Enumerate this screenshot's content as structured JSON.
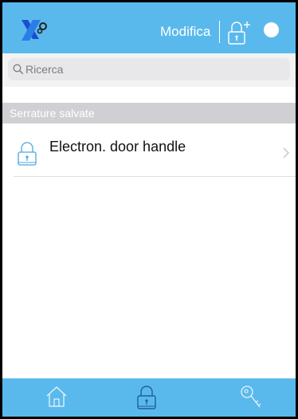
{
  "header": {
    "logo": "x-brand-logo",
    "edit_label": "Modifica",
    "add_lock_icon": "lock-plus-icon",
    "status_dot_color": "#ffffff",
    "bar_color": "#5ab9ec"
  },
  "search": {
    "placeholder": "Ricerca",
    "value": ""
  },
  "section": {
    "title": "Serrature salvate"
  },
  "locks": [
    {
      "name": "Electron. door handle",
      "icon": "lock-icon"
    }
  ],
  "tabbar": {
    "tabs": [
      {
        "id": "home",
        "icon": "home-icon"
      },
      {
        "id": "locks",
        "icon": "lock-icon",
        "selected": true
      },
      {
        "id": "keys",
        "icon": "key-icon"
      }
    ]
  }
}
